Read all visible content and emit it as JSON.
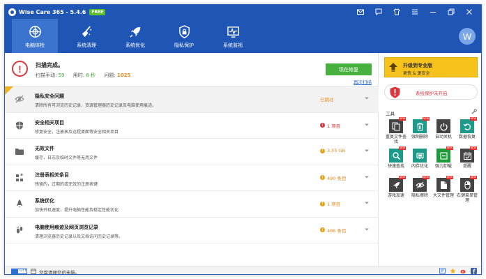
{
  "app": {
    "title": "Wise Care 365 - 5.4.6",
    "badge": "FREE"
  },
  "nav": [
    {
      "label": "电脑体检",
      "icon": "pc-checkup-icon"
    },
    {
      "label": "系统清理",
      "icon": "broom-icon"
    },
    {
      "label": "系统优化",
      "icon": "rocket-icon"
    },
    {
      "label": "隐私保护",
      "icon": "lock-shield-icon"
    },
    {
      "label": "系统监视",
      "icon": "monitor-pulse-icon"
    }
  ],
  "avatar": {
    "letter": "W"
  },
  "scan": {
    "status": "扫描完成。",
    "items_label": "扫描手动:",
    "items_value": "59",
    "time_label": "用时:",
    "time_value": "6 秒",
    "issues_label": "问题:",
    "issues_value": "1025",
    "fix_button": "现在修复",
    "rescan_link": "再次扫描"
  },
  "results": [
    {
      "title": "隐私安全问题",
      "desc": "清除所有可浏览历史记录，资源管理器历史记录及电脑使用痕迹。",
      "status": "已跳过",
      "status_color": "#e7891c",
      "icon": "eye-icon"
    },
    {
      "title": "安全相关项目",
      "desc": "修复安全，注册表及远程桌面等安全相关项目",
      "status": "1 项目",
      "status_color": "#d9363e",
      "icon": "shield-icon"
    },
    {
      "title": "无效文件",
      "desc": "缓存，日志及临时文件等无用文件",
      "status": "3.55 GB",
      "status_color": "#e7891c",
      "icon": "folder-icon"
    },
    {
      "title": "注册表相关条目",
      "desc": "残留的，过期的或无效的注册表键",
      "status": "490 条目",
      "status_color": "#e7891c",
      "icon": "registry-icon"
    },
    {
      "title": "系统优化",
      "desc": "加快开机速度，提升电脑性能及稳定性能优化",
      "status": "1 项目",
      "status_color": "#e7891c",
      "icon": "rocket-icon"
    },
    {
      "title": "电脑使用痕迹及网页浏览记录",
      "desc": "清理浏览器历史记录以及文档访问历史记录等。",
      "status": "486 条目",
      "status_color": "#e7891c",
      "icon": "footprint-icon"
    }
  ],
  "sidebar": {
    "upgrade_line1": "升级到专业版",
    "upgrade_line2": "更快 & 更安全",
    "protection_text": "系统保护未开启",
    "tools_header": "工具"
  },
  "tools": [
    {
      "label": "重复文件查找",
      "icon": "duplicate-file-icon",
      "color": "#444444",
      "new": true
    },
    {
      "label": "强制删除",
      "icon": "trash-icon",
      "color": "#1d9a8a",
      "new": true
    },
    {
      "label": "自动关机",
      "icon": "power-icon",
      "color": "#444444",
      "new": false
    },
    {
      "label": "数据恢复",
      "icon": "data-recovery-icon",
      "color": "#1d9a8a",
      "new": true
    },
    {
      "label": "快速查找",
      "icon": "magnifier-icon",
      "color": "#1d9a8a",
      "new": true
    },
    {
      "label": "内存优化",
      "icon": "memory-icon",
      "color": "#1d9a8a",
      "new": false
    },
    {
      "label": "强力卸载",
      "icon": "uninstall-icon",
      "color": "#1f9a3a",
      "new": true
    },
    {
      "label": "提醒",
      "icon": "calendar-check-icon",
      "color": "#444444",
      "new": true
    },
    {
      "label": "游戏加速",
      "icon": "game-boost-icon",
      "color": "#444444",
      "new": true
    },
    {
      "label": "隐私擦除",
      "icon": "privacy-eraser-icon",
      "color": "#444444",
      "new": true
    },
    {
      "label": "大文件管理",
      "icon": "large-file-icon",
      "color": "#444444",
      "new": true
    },
    {
      "label": "右键菜单管理",
      "icon": "context-menu-icon",
      "color": "#444444",
      "new": true
    }
  ],
  "statusbar": {
    "toggle_text": "OFF",
    "message": "您需清理您的电脑。"
  },
  "colors": {
    "titlebar": "#1f56b6",
    "active_tab": "#3b74cf",
    "fix_button": "#47b03e",
    "upgrade": "#f6c21b"
  }
}
